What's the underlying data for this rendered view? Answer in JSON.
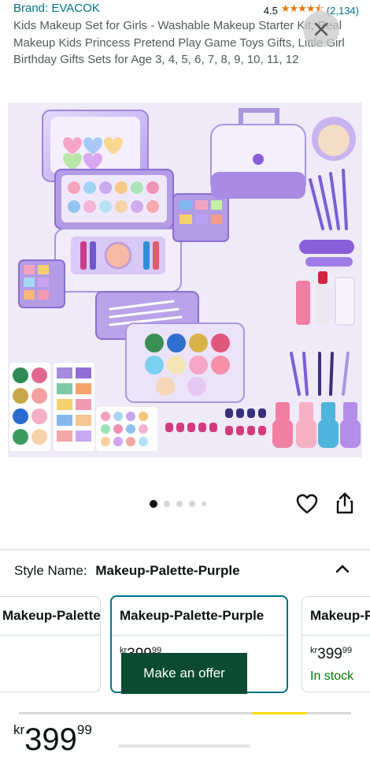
{
  "brand": {
    "text": "Brand: EVACOK"
  },
  "rating": {
    "value": "4.5",
    "stars": "★★★★⯪",
    "count": "(2,134)"
  },
  "product": {
    "title": "Kids Makeup Set for Girls - Washable Makeup Starter Kit, Real Makeup Kids Princess Pretend Play Game Toys Gifts, Little Girl Birthday Gifts Sets for Age 3, 4, 5, 6, 7, 8, 9, 10, 11, 12"
  },
  "gallery": {
    "count": 5,
    "active_index": 0
  },
  "icons": {
    "close": "close-icon",
    "heart": "heart-icon",
    "share": "share-icon",
    "chevron": "chevron-up-icon"
  },
  "style": {
    "label": "Style Name:",
    "value": "Makeup-Palette-Purple"
  },
  "options": [
    {
      "name": "Makeup-Palette-Pink"
    },
    {
      "name": "Makeup-Palette-Purple",
      "price_currency": "kr",
      "price_whole": "399",
      "price_fraction": "99"
    },
    {
      "name": "Makeup-Palette-Purple",
      "price_currency": "kr",
      "price_whole": "399",
      "price_fraction": "99",
      "stock": "In stock"
    }
  ],
  "offer_button": {
    "label": "Make an offer"
  },
  "price": {
    "currency": "kr",
    "whole": "399",
    "fraction": "99"
  },
  "colors": {
    "link": "#007185",
    "offer_bg": "#0b4b32",
    "selected_border": "#007185",
    "in_stock": "#007600",
    "star": "#e77600"
  }
}
